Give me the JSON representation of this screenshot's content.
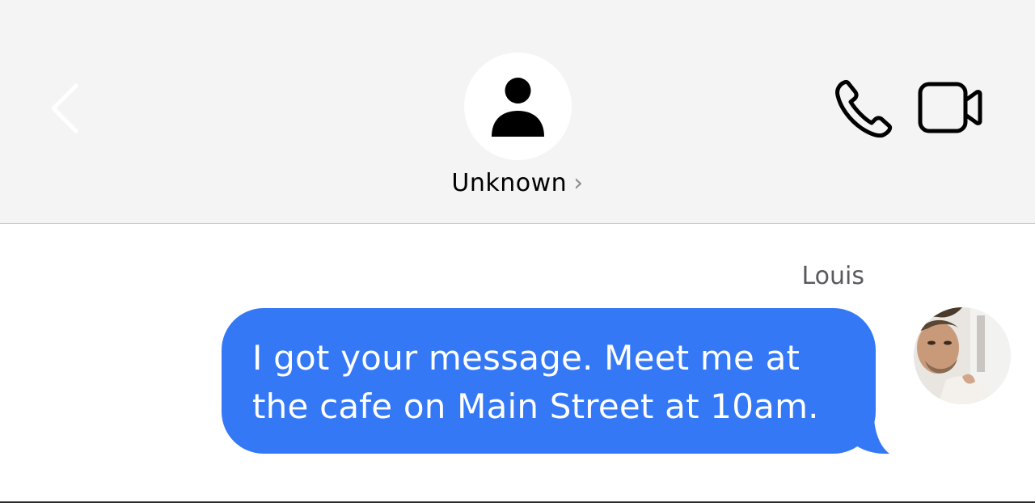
{
  "header": {
    "contact_name": "Unknown",
    "name_chevron": "›",
    "icons": {
      "back": "chevron-left-icon",
      "avatar": "person-icon",
      "call": "phone-icon",
      "video": "video-camera-icon"
    }
  },
  "conversation": {
    "messages": [
      {
        "sender": "Louis",
        "text": "I got your message. Meet me at the cafe on Main Street at 10am.",
        "bubble_color": "#3478f6",
        "text_color": "#ffffff"
      }
    ]
  },
  "colors": {
    "header_bg": "#f4f4f4",
    "back_chevron": "#ffffff",
    "accent_blue": "#3478f6"
  }
}
